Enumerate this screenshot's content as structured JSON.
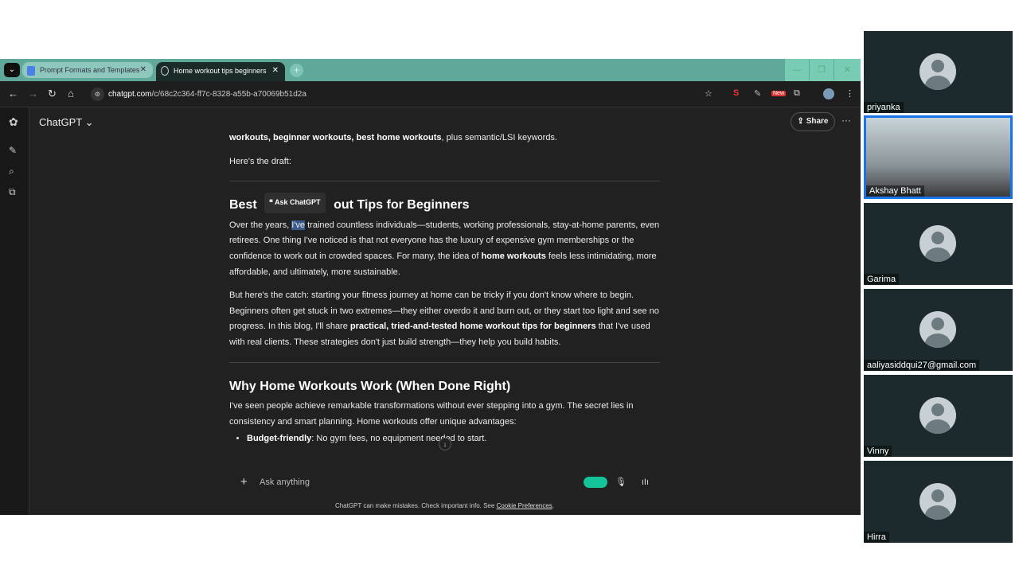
{
  "browser": {
    "tabs": [
      {
        "label": "Prompt Formats and Templates"
      },
      {
        "label": "Home workout tips beginners"
      }
    ],
    "url_domain": "chatgpt.com",
    "url_path": "/c/68c2c364-ff7c-8328-a55b-a70069b51d2a",
    "ext_new_badge": "New"
  },
  "app": {
    "title": "ChatGPT",
    "share": "Share"
  },
  "content": {
    "intro_bold": "workouts, beginner workouts, best home workouts",
    "intro_rest": ", plus semantic/LSI keywords.",
    "draft": "Here's the draft:",
    "h1_a": "Best ",
    "h1_b": "out Tips for Beginners",
    "ask_popup": "Ask ChatGPT",
    "p1_a": "Over the years, ",
    "p1_hl": "I've",
    "p1_b": " trained countless individuals—students, working professionals, stay-at-home parents, even retirees. One thing I've noticed is that not everyone has the luxury of expensive gym memberships or the confidence to work out in crowded spaces. For many, the idea of ",
    "p1_bold": "home workouts",
    "p1_c": " feels less intimidating, more affordable, and ultimately, more sustainable.",
    "p2_a": "But here's the catch: starting your fitness journey at home can be tricky if you don't know where to begin. Beginners often get stuck in two extremes—they either overdo it and burn out, or they start too light and see no progress. In this blog, I'll share ",
    "p2_bold": "practical, tried-and-tested home workout tips for beginners",
    "p2_b": " that I've used with real clients. These strategies don't just build strength—they help you build habits.",
    "h2": "Why Home Workouts Work (When Done Right)",
    "p3": "I've seen people achieve remarkable transformations without ever stepping into a gym. The secret lies in consistency and smart planning. Home workouts offer unique advantages:",
    "bullet1_bold": "Budget-friendly",
    "bullet1": ": No gym fees, no equipment needed to start."
  },
  "composer": {
    "placeholder": "Ask anything",
    "disclaimer": "ChatGPT can make mistakes. Check important info. See ",
    "cookie_link": "Cookie Preferences",
    "period": "."
  },
  "participants": [
    {
      "name": "priyanka"
    },
    {
      "name": "Akshay Bhatt"
    },
    {
      "name": "Garima"
    },
    {
      "name": "aaliyasiddqui27@gmail.com"
    },
    {
      "name": "Vinny"
    },
    {
      "name": "Hirra"
    }
  ]
}
